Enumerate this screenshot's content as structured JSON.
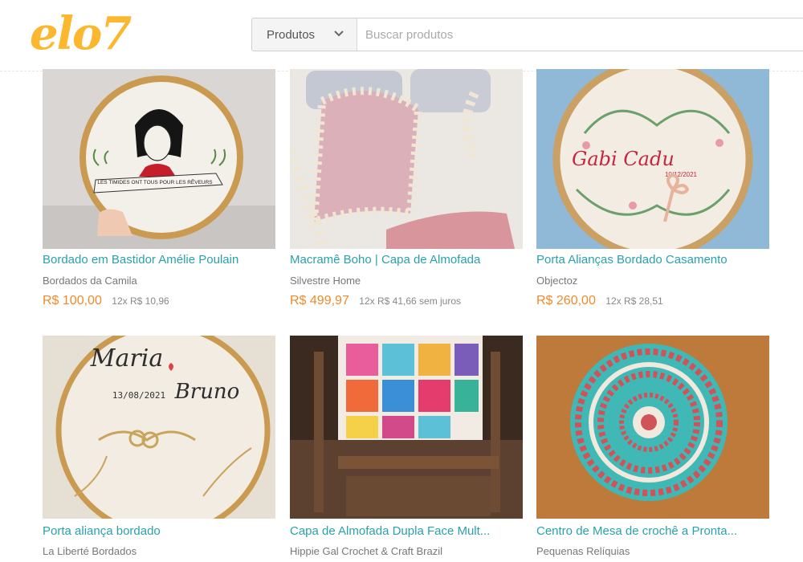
{
  "header": {
    "logo_text": "elo7",
    "category_selected": "Produtos",
    "search_placeholder": "Buscar produtos",
    "brand_color": "#fbb82f"
  },
  "colors": {
    "title": "#2aa1ad",
    "price": "#f08a2a",
    "muted": "#777777"
  },
  "products": [
    {
      "title": "Bordado em Bastidor Amélie Poulain",
      "seller": "Bordados da Camila",
      "price": "R$ 100,00",
      "installments": "12x R$ 10,96",
      "image_text": "LES TIMIDES ONT TOUS POUR LES RÊVEURS"
    },
    {
      "title": "Macramê Boho | Capa de Almofada",
      "seller": "Silvestre Home",
      "price": "R$ 499,97",
      "installments": "12x R$ 41,66 sem juros"
    },
    {
      "title": "Porta Alianças Bordado Casamento",
      "seller": "Objectoz",
      "price": "R$ 260,00",
      "installments": "12x R$ 28,51",
      "image_text": "Gabi Cadu",
      "image_date": "10/12/2021"
    },
    {
      "title": "Porta aliança bordado",
      "seller": "La Liberté Bordados",
      "image_name_1": "Maria",
      "image_name_2": "Bruno",
      "image_date": "13/08/2021"
    },
    {
      "title": "Capa de Almofada Dupla Face Mult...",
      "seller": "Hippie Gal Crochet & Craft Brazil"
    },
    {
      "title": "Centro de Mesa de crochê a Pronta...",
      "seller": "Pequenas Relíquias"
    }
  ]
}
